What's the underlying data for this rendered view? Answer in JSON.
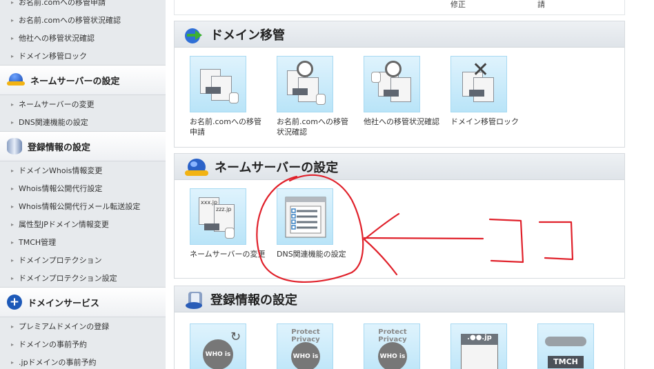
{
  "sidebar": {
    "migration_items": [
      "お名前.comへの移管申請",
      "お名前.comへの移管状況確認",
      "他社への移管状況確認",
      "ドメイン移管ロック"
    ],
    "ns_title": "ネームサーバーの設定",
    "ns_items": [
      "ネームサーバーの変更",
      "DNS関連機能の設定"
    ],
    "reg_title": "登録情報の設定",
    "reg_items": [
      "ドメインWhois情報変更",
      "Whois情報公開代行設定",
      "Whois情報公開代行メール転送設定",
      "属性型JPドメイン情報変更",
      "TMCH管理",
      "ドメインプロテクション",
      "ドメインプロテクション設定"
    ],
    "svc_title": "ドメインサービス",
    "svc_items": [
      "プレミアムドメインの登録",
      "ドメインの事前予約",
      ".jpドメインの事前予約"
    ]
  },
  "top_strip": {
    "text_a": "修正",
    "text_b": "請"
  },
  "migration_panel": {
    "title": "ドメイン移管",
    "tiles": [
      "お名前.comへの移管申請",
      "お名前.comへの移管状況確認",
      "他社への移管状況確認",
      "ドメイン移管ロック"
    ]
  },
  "ns_panel": {
    "title": "ネームサーバーの設定",
    "tiles": [
      "ネームサーバーの変更",
      "DNS関連機能の設定"
    ],
    "icon_texts": {
      "xxx": "xxx.jp",
      "zzz": "zzz.jp"
    }
  },
  "reg_panel": {
    "title": "登録情報の設定",
    "tile_texts": {
      "who": "WHO is",
      "privacy": "Protect Privacy",
      "jp": ".●●.jp",
      "tmch": "TMCH"
    }
  },
  "annotation": {
    "text": "ココ",
    "color": "#e0202a"
  },
  "colors": {
    "tile_bg": "#c7ebfb",
    "tile_border": "#a7d9f2",
    "accent_red": "#e0202a"
  }
}
